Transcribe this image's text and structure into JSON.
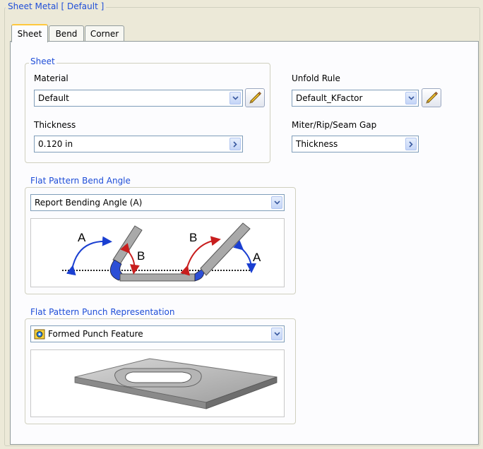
{
  "panel": {
    "title": "Sheet Metal [ Default ]"
  },
  "tabs": [
    {
      "label": "Sheet",
      "active": true
    },
    {
      "label": "Bend",
      "active": false
    },
    {
      "label": "Corner",
      "active": false
    }
  ],
  "sheet_group": {
    "title": "Sheet",
    "material": {
      "label": "Material",
      "value": "Default"
    },
    "thickness": {
      "label": "Thickness",
      "value": "0.120 in"
    }
  },
  "unfold": {
    "label": "Unfold Rule",
    "value": "Default_KFactor",
    "gap_label": "Miter/Rip/Seam Gap",
    "gap_value": "Thickness"
  },
  "bend_angle": {
    "title": "Flat Pattern Bend Angle",
    "value": "Report Bending Angle (A)",
    "diagram_labels": {
      "a_left": "A",
      "b_left": "B",
      "b_right": "B",
      "a_right": "A"
    }
  },
  "punch": {
    "title": "Flat Pattern Punch Representation",
    "value": "Formed Punch Feature"
  },
  "icons": {
    "dropdown": "chevron-down-icon",
    "browse": "chevron-right-icon",
    "edit": "pencil-icon",
    "punch": "punch-feature-icon"
  },
  "colors": {
    "group_title": "#1f4ed8",
    "arrow_a": "#1a3fd1",
    "arrow_b": "#c81e1e",
    "bend_highlight": "#2d4fd6"
  }
}
